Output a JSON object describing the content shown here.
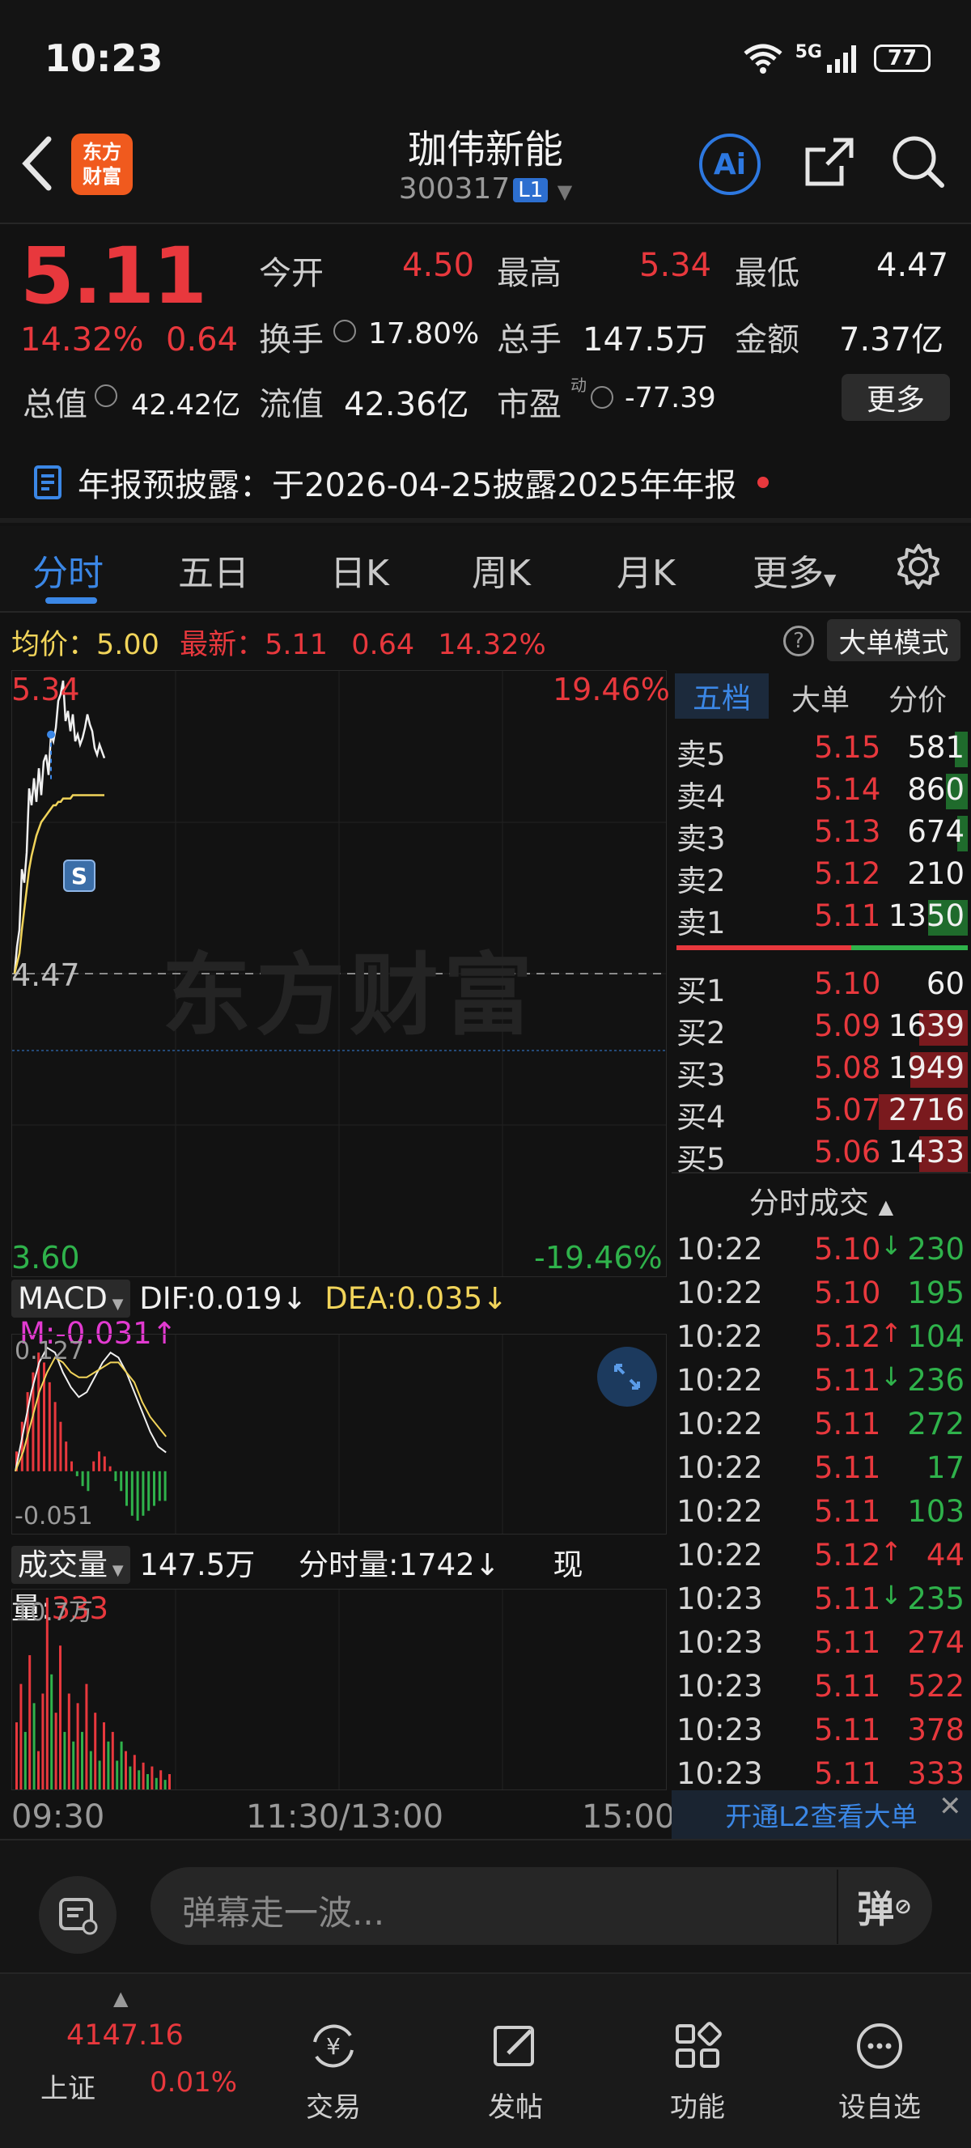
{
  "status_bar": {
    "time": "10:23",
    "network": "5G",
    "battery": "77"
  },
  "header": {
    "back": "back",
    "logo_text": "东方财富",
    "stock_name": "珈伟新能",
    "stock_code": "300317",
    "level_badge": "L1"
  },
  "quote": {
    "price": "5.11",
    "change_pct": "14.32%",
    "change_amt": "0.64",
    "fields": [
      {
        "label": "今开",
        "value": "4.50"
      },
      {
        "label": "最高",
        "value": "5.34"
      },
      {
        "label": "最低",
        "value": "4.47"
      },
      {
        "label": "换手",
        "value": "17.80%"
      },
      {
        "label": "总手",
        "value": "147.5万"
      },
      {
        "label": "金额",
        "value": "7.37亿"
      },
      {
        "label": "总值",
        "value": "42.42亿"
      },
      {
        "label": "流值",
        "value": "42.36亿"
      },
      {
        "label": "市盈",
        "sup": "动",
        "value": "-77.39"
      }
    ],
    "more_label": "更多",
    "notice": "年报预披露：于2026-04-25披露2025年年报"
  },
  "tabs": [
    "分时",
    "五日",
    "日K",
    "周K",
    "月K",
    "更多"
  ],
  "info_line": {
    "avg_label": "均价：",
    "avg_value": "5.00",
    "latest_label": "最新：",
    "latest_value": "5.11",
    "change": "0.64",
    "pct": "14.32%",
    "big_order_mode": "大单模式"
  },
  "chart_data": {
    "type": "line",
    "title": "",
    "y_top": "5.34",
    "y_mid": "4.47",
    "y_bottom": "3.60",
    "pct_top": "19.46%",
    "pct_bottom": "-19.46%",
    "ylim": [
      3.6,
      5.34
    ],
    "x_labels": [
      "09:30",
      "11:30/13:00",
      "15:00"
    ],
    "series": [
      {
        "name": "最新",
        "values": [
          4.47,
          4.55,
          4.6,
          4.78,
          4.74,
          4.83,
          5.02,
          4.97,
          5.05,
          4.98,
          5.08,
          5.0,
          5.1,
          5.12,
          5.06,
          5.18,
          5.16,
          5.2,
          5.28,
          5.3,
          5.34,
          5.22,
          5.25,
          5.19,
          5.24,
          5.16,
          5.18,
          5.15,
          5.17,
          5.2,
          5.24,
          5.21,
          5.19,
          5.14,
          5.12,
          5.15,
          5.13,
          5.11
        ]
      },
      {
        "name": "均价",
        "values": [
          4.47,
          4.5,
          4.53,
          4.6,
          4.66,
          4.72,
          4.78,
          4.82,
          4.85,
          4.88,
          4.9,
          4.92,
          4.93,
          4.94,
          4.95,
          4.96,
          4.97,
          4.97,
          4.98,
          4.98,
          4.99,
          4.99,
          4.99,
          4.99,
          5.0,
          5.0,
          5.0,
          5.0,
          5.0,
          5.0,
          5.0,
          5.0,
          5.0,
          5.0,
          5.0,
          5.0,
          5.0,
          5.0
        ]
      }
    ],
    "marker_label": "S"
  },
  "macd": {
    "label": "MACD",
    "dif_label": "DIF:",
    "dif": "0.019",
    "dea_label": "DEA:",
    "dea": "0.035",
    "m_label": "M:",
    "m": "-0.031",
    "top": "0.127",
    "bottom": "-0.051",
    "bars": [
      0.02,
      0.05,
      0.08,
      0.1,
      0.12,
      0.11,
      0.09,
      0.07,
      0.05,
      0.03,
      0.01,
      -0.005,
      -0.015,
      -0.02,
      0.01,
      0.02,
      0.015,
      0.005,
      -0.01,
      -0.02,
      -0.035,
      -0.045,
      -0.05,
      -0.045,
      -0.04,
      -0.035,
      -0.03,
      -0.03
    ],
    "dif_line": [
      0.0,
      0.04,
      0.08,
      0.11,
      0.125,
      0.12,
      0.1,
      0.085,
      0.075,
      0.08,
      0.095,
      0.11,
      0.12,
      0.115,
      0.1,
      0.08,
      0.06,
      0.04,
      0.025,
      0.019
    ],
    "dea_line": [
      0.0,
      0.02,
      0.05,
      0.08,
      0.1,
      0.115,
      0.11,
      0.1,
      0.095,
      0.095,
      0.1,
      0.105,
      0.11,
      0.11,
      0.1,
      0.09,
      0.07,
      0.055,
      0.045,
      0.035
    ]
  },
  "volume": {
    "label": "成交量",
    "total": "147.5万",
    "tick_label": "分时量:",
    "tick_value": "1742",
    "now_label": "现量:",
    "now_value": "333",
    "top": "10.7万",
    "bars": [
      0.35,
      0.55,
      0.3,
      0.7,
      0.45,
      0.2,
      0.5,
      1.0,
      0.6,
      0.4,
      0.75,
      0.3,
      0.5,
      0.25,
      0.45,
      0.3,
      0.55,
      0.2,
      0.4,
      0.15,
      0.35,
      0.25,
      0.3,
      0.15,
      0.25,
      0.2,
      0.12,
      0.18,
      0.1,
      0.14,
      0.08,
      0.12,
      0.06,
      0.1,
      0.05,
      0.08
    ],
    "colors": [
      "r",
      "r",
      "g",
      "r",
      "g",
      "r",
      "r",
      "r",
      "g",
      "r",
      "r",
      "g",
      "r",
      "g",
      "r",
      "g",
      "r",
      "g",
      "r",
      "g",
      "r",
      "g",
      "r",
      "g",
      "g",
      "r",
      "g",
      "r",
      "g",
      "r",
      "g",
      "r",
      "g",
      "r",
      "g",
      "r"
    ]
  },
  "orderbook": {
    "tabs": [
      "五档",
      "大单",
      "分价"
    ],
    "asks": [
      {
        "label": "卖5",
        "price": "5.15",
        "vol": "581",
        "bar": 0.15
      },
      {
        "label": "卖4",
        "price": "5.14",
        "vol": "860",
        "bar": 0.25
      },
      {
        "label": "卖3",
        "price": "5.13",
        "vol": "674",
        "bar": 0.12
      },
      {
        "label": "卖2",
        "price": "5.12",
        "vol": "210",
        "bar": 0.0
      },
      {
        "label": "卖1",
        "price": "5.11",
        "vol": "1350",
        "bar": 0.45
      }
    ],
    "bids": [
      {
        "label": "买1",
        "price": "5.10",
        "vol": "60",
        "bar": 0.0
      },
      {
        "label": "买2",
        "price": "5.09",
        "vol": "1639",
        "bar": 0.55
      },
      {
        "label": "买3",
        "price": "5.08",
        "vol": "1949",
        "bar": 0.65
      },
      {
        "label": "买4",
        "price": "5.07",
        "vol": "2716",
        "bar": 1.0
      },
      {
        "label": "买5",
        "price": "5.06",
        "vol": "1433",
        "bar": 0.55
      }
    ],
    "trades_header": "分时成交",
    "trades": [
      {
        "t": "10:22",
        "p": "5.10",
        "dir": "down",
        "v": "230",
        "vc": "green"
      },
      {
        "t": "10:22",
        "p": "5.10",
        "dir": "",
        "v": "195",
        "vc": "green"
      },
      {
        "t": "10:22",
        "p": "5.12",
        "dir": "up",
        "v": "104",
        "vc": "green"
      },
      {
        "t": "10:22",
        "p": "5.11",
        "dir": "down",
        "v": "236",
        "vc": "green"
      },
      {
        "t": "10:22",
        "p": "5.11",
        "dir": "",
        "v": "272",
        "vc": "green"
      },
      {
        "t": "10:22",
        "p": "5.11",
        "dir": "",
        "v": "17",
        "vc": "green"
      },
      {
        "t": "10:22",
        "p": "5.11",
        "dir": "",
        "v": "103",
        "vc": "green"
      },
      {
        "t": "10:22",
        "p": "5.12",
        "dir": "up",
        "v": "44",
        "vc": "red"
      },
      {
        "t": "10:23",
        "p": "5.11",
        "dir": "down",
        "v": "235",
        "vc": "green"
      },
      {
        "t": "10:23",
        "p": "5.11",
        "dir": "",
        "v": "274",
        "vc": "red"
      },
      {
        "t": "10:23",
        "p": "5.11",
        "dir": "",
        "v": "522",
        "vc": "red"
      },
      {
        "t": "10:23",
        "p": "5.11",
        "dir": "",
        "v": "378",
        "vc": "red"
      },
      {
        "t": "10:23",
        "p": "5.11",
        "dir": "",
        "v": "333",
        "vc": "red"
      }
    ],
    "l2_text": "开通L2查看大单"
  },
  "danmu": {
    "placeholder": "弹幕走一波...",
    "toggle": "弹"
  },
  "bottom_nav": {
    "index_value": "4147.16",
    "index_name": "上证",
    "index_change": "0.01%",
    "items": [
      "交易",
      "发帖",
      "功能",
      "设自选"
    ]
  },
  "colors": {
    "up": "#e8383d",
    "down": "#2fb24b",
    "accent": "#3b87e6",
    "avg_line": "#f1d45a"
  },
  "watermark": "东方财富"
}
